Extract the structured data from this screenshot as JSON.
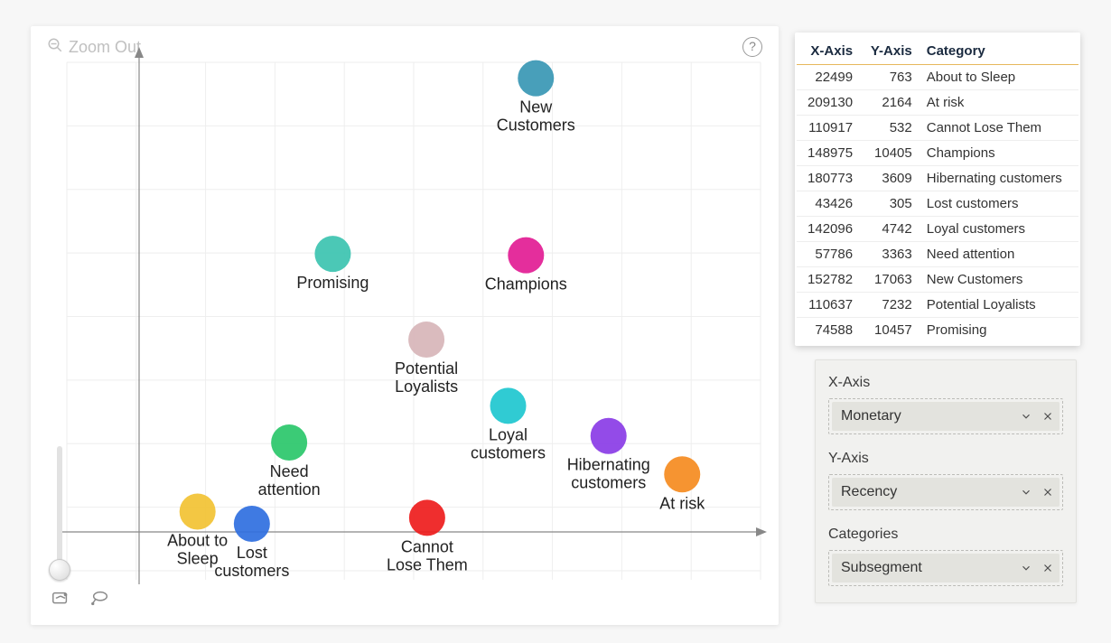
{
  "zoom_out_label": "Zoom Out",
  "help_icon_name": "question-circle-icon",
  "chart_data": {
    "type": "scatter",
    "xlabel": "Monetary",
    "ylabel": "Recency",
    "xlim": [
      0,
      240000
    ],
    "ylim": [
      0,
      18000
    ],
    "series": [
      {
        "name": "About to Sleep",
        "x": 22499,
        "y": 763,
        "color": "#f2c233"
      },
      {
        "name": "At risk",
        "x": 209130,
        "y": 2164,
        "color": "#f58b1f"
      },
      {
        "name": "Cannot Lose Them",
        "x": 110917,
        "y": 532,
        "color": "#ee1c1c"
      },
      {
        "name": "Champions",
        "x": 148975,
        "y": 10405,
        "color": "#e21c94"
      },
      {
        "name": "Hibernating customers",
        "x": 180773,
        "y": 3609,
        "color": "#8a3ce6"
      },
      {
        "name": "Lost customers",
        "x": 43426,
        "y": 305,
        "color": "#2f6fe0"
      },
      {
        "name": "Loyal customers",
        "x": 142096,
        "y": 4742,
        "color": "#1ec7cf"
      },
      {
        "name": "Need attention",
        "x": 57786,
        "y": 3363,
        "color": "#2ac76a"
      },
      {
        "name": "New Customers",
        "x": 152782,
        "y": 17063,
        "color": "#3897b4"
      },
      {
        "name": "Potential Loyalists",
        "x": 110637,
        "y": 7232,
        "color": "#d7b5b9"
      },
      {
        "name": "Promising",
        "x": 74588,
        "y": 10457,
        "color": "#3cc3b0"
      }
    ],
    "bubble_radius": 20
  },
  "table": {
    "headers": {
      "x": "X-Axis",
      "y": "Y-Axis",
      "cat": "Category"
    },
    "rows": [
      {
        "x": 22499,
        "y": 763,
        "cat": "About to Sleep"
      },
      {
        "x": 209130,
        "y": 2164,
        "cat": "At risk"
      },
      {
        "x": 110917,
        "y": 532,
        "cat": "Cannot Lose Them"
      },
      {
        "x": 148975,
        "y": 10405,
        "cat": "Champions"
      },
      {
        "x": 180773,
        "y": 3609,
        "cat": "Hibernating customers"
      },
      {
        "x": 43426,
        "y": 305,
        "cat": "Lost customers"
      },
      {
        "x": 142096,
        "y": 4742,
        "cat": "Loyal customers"
      },
      {
        "x": 57786,
        "y": 3363,
        "cat": "Need attention"
      },
      {
        "x": 152782,
        "y": 17063,
        "cat": "New Customers"
      },
      {
        "x": 110637,
        "y": 7232,
        "cat": "Potential Loyalists"
      },
      {
        "x": 74588,
        "y": 10457,
        "cat": "Promising"
      }
    ]
  },
  "fields": {
    "x": {
      "label": "X-Axis",
      "value": "Monetary"
    },
    "y": {
      "label": "Y-Axis",
      "value": "Recency"
    },
    "cat": {
      "label": "Categories",
      "value": "Subsegment"
    }
  },
  "bubble_labels": {
    "About to Sleep": [
      "About to",
      "Sleep"
    ],
    "At risk": [
      "At risk"
    ],
    "Cannot Lose Them": [
      "Cannot",
      "Lose Them"
    ],
    "Champions": [
      "Champions"
    ],
    "Hibernating customers": [
      "Hibernating",
      "customers"
    ],
    "Lost customers": [
      "Lost",
      "customers"
    ],
    "Loyal customers": [
      "Loyal",
      "customers"
    ],
    "Need attention": [
      "Need",
      "attention"
    ],
    "New Customers": [
      "New",
      "Customers"
    ],
    "Potential Loyalists": [
      "Potential",
      "Loyalists"
    ],
    "Promising": [
      "Promising"
    ]
  }
}
